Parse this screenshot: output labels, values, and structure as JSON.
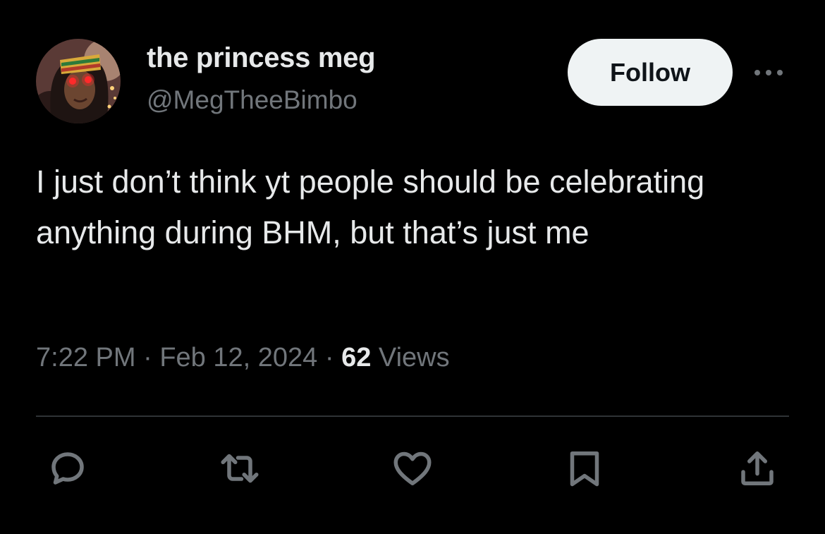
{
  "tweet": {
    "display_name": "the princess meg",
    "handle": "@MegTheeBimbo",
    "follow_label": "Follow",
    "text": "I just don’t think yt people should be celebrating anything during BHM, but that’s just me",
    "time": "7:22 PM",
    "separator": "·",
    "date": "Feb 12, 2024",
    "views_count": "62",
    "views_label": "Views"
  },
  "icons": {
    "more": "more-horizontal-icon",
    "reply": "reply-icon",
    "retweet": "retweet-icon",
    "like": "heart-icon",
    "bookmark": "bookmark-icon",
    "share": "share-icon"
  },
  "colors": {
    "background": "#000000",
    "primary_text": "#e7e9ea",
    "secondary_text": "#71767b",
    "follow_button_bg": "#eff3f4",
    "follow_button_text": "#0f1419",
    "divider": "#2f3336"
  }
}
